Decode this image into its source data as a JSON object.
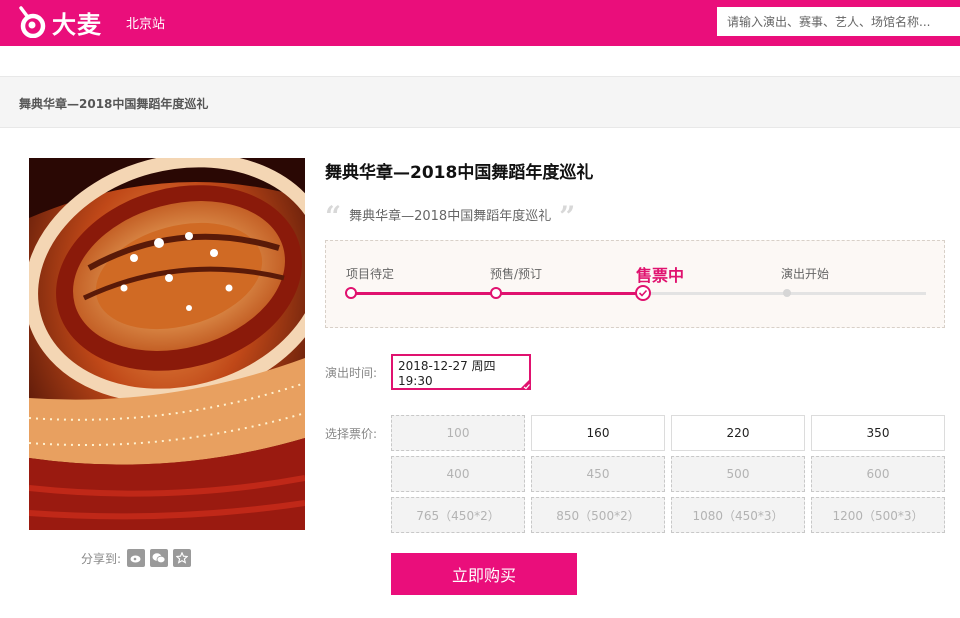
{
  "header": {
    "brand": "大麦",
    "city": "北京站",
    "search_placeholder": "请输入演出、赛事、艺人、场馆名称..."
  },
  "breadcrumb": "舞典华章—2018中国舞蹈年度巡礼",
  "event": {
    "title": "舞典华章—2018中国舞蹈年度巡礼",
    "subtitle": "舞典华章—2018中国舞蹈年度巡礼",
    "steps": [
      {
        "label": "项目待定",
        "state": "done"
      },
      {
        "label": "预售/预订",
        "state": "done"
      },
      {
        "label": "售票中",
        "state": "current"
      },
      {
        "label": "演出开始",
        "state": "pending"
      }
    ],
    "time_label": "演出时间:",
    "time_value": "2018-12-27 周四 19:30",
    "price_label": "选择票价:",
    "prices": [
      {
        "label": "100",
        "available": false
      },
      {
        "label": "160",
        "available": true
      },
      {
        "label": "220",
        "available": true
      },
      {
        "label": "350",
        "available": true
      },
      {
        "label": "400",
        "available": false
      },
      {
        "label": "450",
        "available": false
      },
      {
        "label": "500",
        "available": false
      },
      {
        "label": "600",
        "available": false
      },
      {
        "label": "765（450*2）",
        "available": false
      },
      {
        "label": "850（500*2）",
        "available": false
      },
      {
        "label": "1080（450*3）",
        "available": false
      },
      {
        "label": "1200（500*3）",
        "available": false
      }
    ],
    "buy_label": "立即购买",
    "share_label": "分享到:",
    "share_icons": [
      "weibo-icon",
      "wechat-icon",
      "favorite-star-icon"
    ]
  },
  "colors": {
    "brand": "#ea0e7b",
    "accent": "#e0126f"
  }
}
